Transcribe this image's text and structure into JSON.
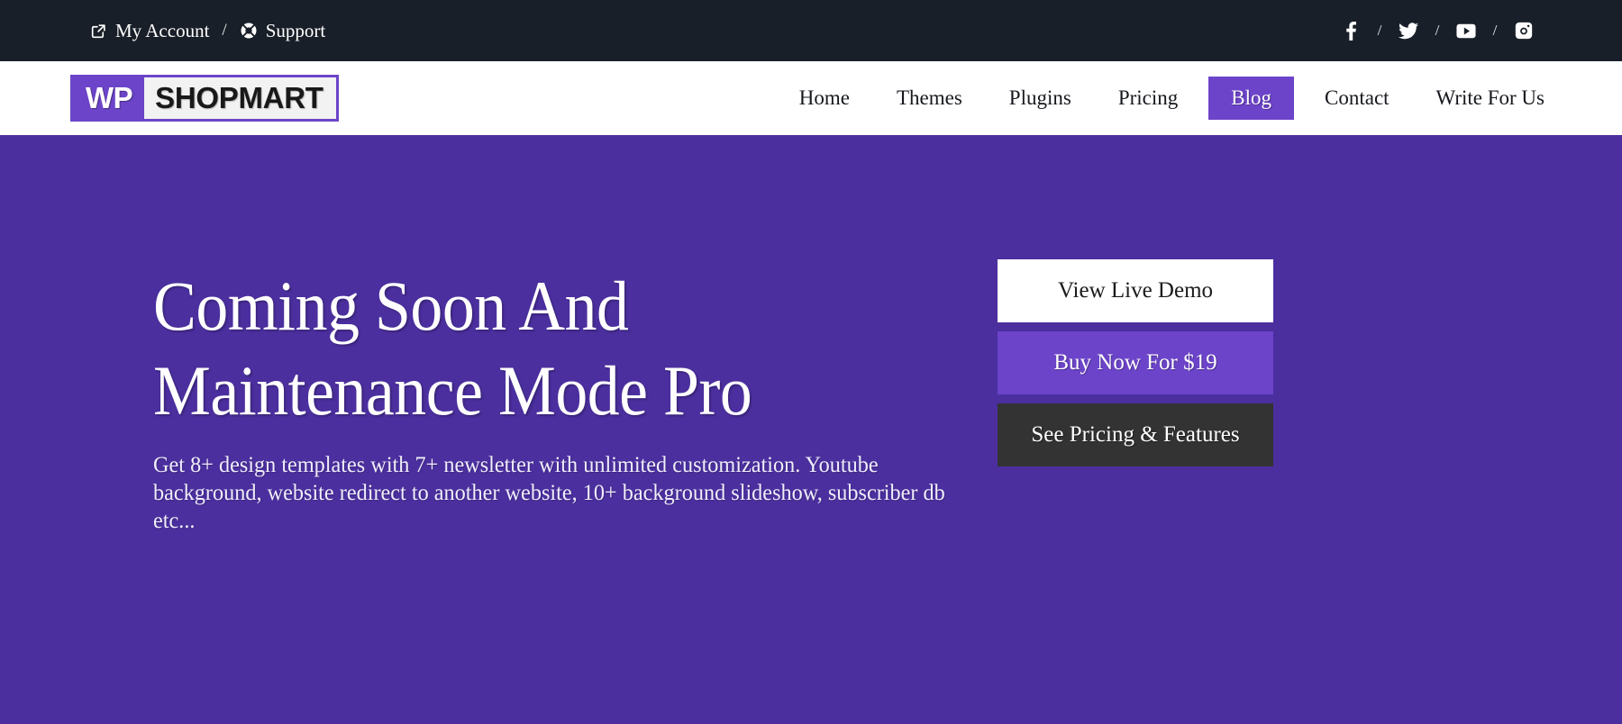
{
  "topbar": {
    "background": "#191f28",
    "links": [
      {
        "label": "My Account",
        "icon": "external-link-icon"
      },
      {
        "label": "Support",
        "icon": "life-ring-icon"
      }
    ],
    "separator": "/",
    "social": [
      {
        "name": "facebook-icon"
      },
      {
        "name": "twitter-icon"
      },
      {
        "name": "youtube-icon"
      },
      {
        "name": "instagram-icon"
      }
    ],
    "social_separator": "/"
  },
  "navbar": {
    "background": "#ffffff",
    "logo": {
      "part1": "WP",
      "part2": "SHOPMART",
      "accent": "#6c44c9"
    },
    "items": [
      {
        "label": "Home",
        "active": false
      },
      {
        "label": "Themes",
        "active": false
      },
      {
        "label": "Plugins",
        "active": false
      },
      {
        "label": "Pricing",
        "active": false
      },
      {
        "label": "Blog",
        "active": true
      },
      {
        "label": "Contact",
        "active": false
      },
      {
        "label": "Write For Us",
        "active": false
      }
    ]
  },
  "hero": {
    "background": "#4b2f9e",
    "title_line1": "Coming Soon And",
    "title_line2": "Maintenance Mode Pro",
    "description": "Get 8+ design templates with 7+ newsletter with unlimited customization. Youtube background, website redirect to another website, 10+ background slideshow, subscriber db etc...",
    "buttons": [
      {
        "label": "View Live Demo",
        "style": "demo",
        "bg": "#ffffff",
        "fg": "#1b1b1b"
      },
      {
        "label": "Buy Now For $19",
        "style": "buy",
        "bg": "#6c44c9",
        "fg": "#ffffff"
      },
      {
        "label": "See Pricing & Features",
        "style": "pricing",
        "bg": "#333333",
        "fg": "#ffffff"
      }
    ]
  }
}
